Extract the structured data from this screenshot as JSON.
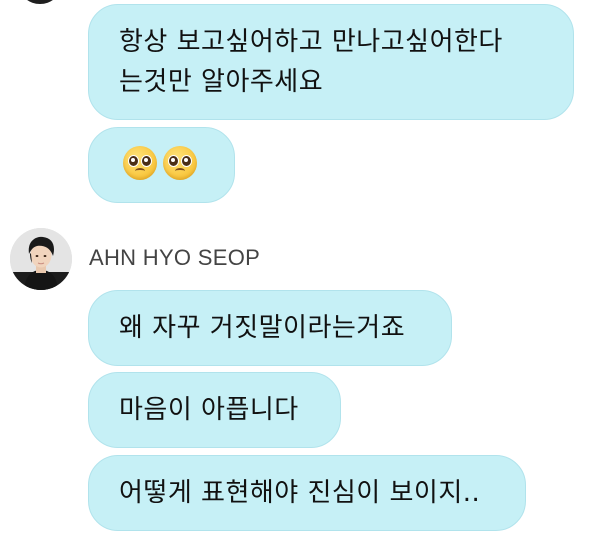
{
  "messages": [
    {
      "lines": [
        "항상 보고싶어하고 만나고싶어한다",
        "는것만 알아주세요"
      ]
    },
    {
      "emojis": [
        "pleading-face-icon",
        "pleading-face-icon"
      ]
    },
    {
      "text": "왜 자꾸 거짓말이라는거죠"
    },
    {
      "text": "마음이 아픕니다"
    },
    {
      "text": "어떻게 표현해야 진심이 보이지.."
    }
  ],
  "sender": {
    "name": "AHN HYO SEOP",
    "avatar": "profile-photo"
  },
  "colors": {
    "bubble_bg": "#c6f0f6",
    "bubble_border": "#b1e3ec",
    "name_text": "#444444"
  }
}
